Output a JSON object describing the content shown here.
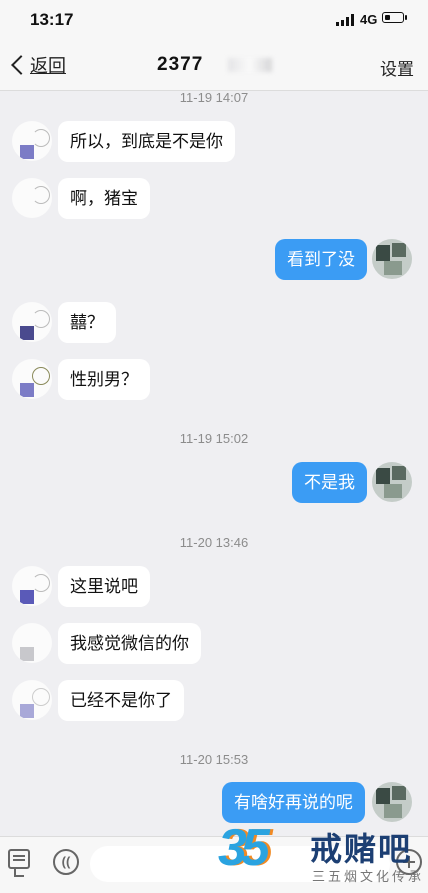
{
  "status_bar": {
    "time": "13:17",
    "network": "4G"
  },
  "nav": {
    "back_label": "返回",
    "title": "2377",
    "settings_label": "设置"
  },
  "messages": [
    {
      "type": "timestamp",
      "text": "11-19 14:07"
    },
    {
      "type": "in",
      "text": "所以，到底是不是你"
    },
    {
      "type": "in",
      "text": "啊，猪宝"
    },
    {
      "type": "out",
      "text": "看到了没"
    },
    {
      "type": "in",
      "text": "囍？"
    },
    {
      "type": "in",
      "text": "性别男？"
    },
    {
      "type": "timestamp",
      "text": "11-19 15:02"
    },
    {
      "type": "out",
      "text": "不是我"
    },
    {
      "type": "timestamp",
      "text": "11-20 13:46"
    },
    {
      "type": "in",
      "text": "这里说吧"
    },
    {
      "type": "in",
      "text": "我感觉微信的你"
    },
    {
      "type": "in",
      "text": "已经不是你了"
    },
    {
      "type": "timestamp",
      "text": "11-20 15:53"
    },
    {
      "type": "out",
      "text": "有啥好再说的呢"
    }
  ],
  "input_bar": {
    "icons": [
      "keyboard-icon",
      "voice-icon",
      "plus-icon"
    ]
  },
  "watermark": {
    "number": "35",
    "name": "戒赌吧",
    "slogan": "三五烟文化传承"
  },
  "colors": {
    "outgoing_bubble": "#3b9cf4",
    "incoming_bubble": "#ffffff",
    "background": "#efeff2"
  }
}
